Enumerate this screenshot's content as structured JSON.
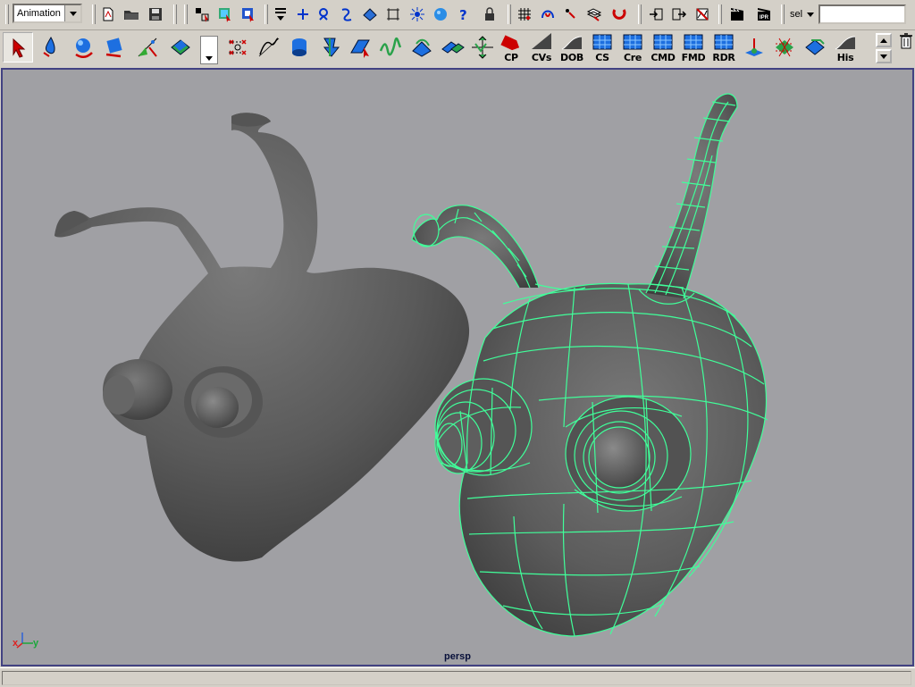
{
  "status_line": {
    "menu_set": "Animation",
    "sel_label": "sel",
    "sel_field_value": ""
  },
  "shelf": {
    "labels": [
      "CP",
      "CVs",
      "DOB",
      "CS",
      "Cre",
      "CMD",
      "FMD",
      "RDR",
      "His"
    ]
  },
  "viewport": {
    "camera": "persp",
    "axis_x": "x",
    "axis_y": "y"
  },
  "colors": {
    "ui_gray": "#d4d0c8",
    "viewport_bg": "#a0a0a4",
    "viewport_border": "#424282",
    "wireframe": "#40ff9a",
    "model_shade": "#5a5a5a"
  },
  "status_icons": [
    "undo-icon",
    "open-file-icon",
    "save-icon",
    "select-hierarchy-icon",
    "select-object-icon",
    "select-component-icon",
    "snap-grid-icon",
    "snap-curve-icon",
    "snap-point-icon",
    "snap-view-plane-icon",
    "make-live-icon",
    "history-icon",
    "render-icon",
    "ipr-icon"
  ],
  "shelf_icons": [
    "select-tool-icon",
    "lasso-tool-icon",
    "move-tool-icon",
    "rotate-tool-icon",
    "scale-tool-icon",
    "manipulator-icon"
  ]
}
